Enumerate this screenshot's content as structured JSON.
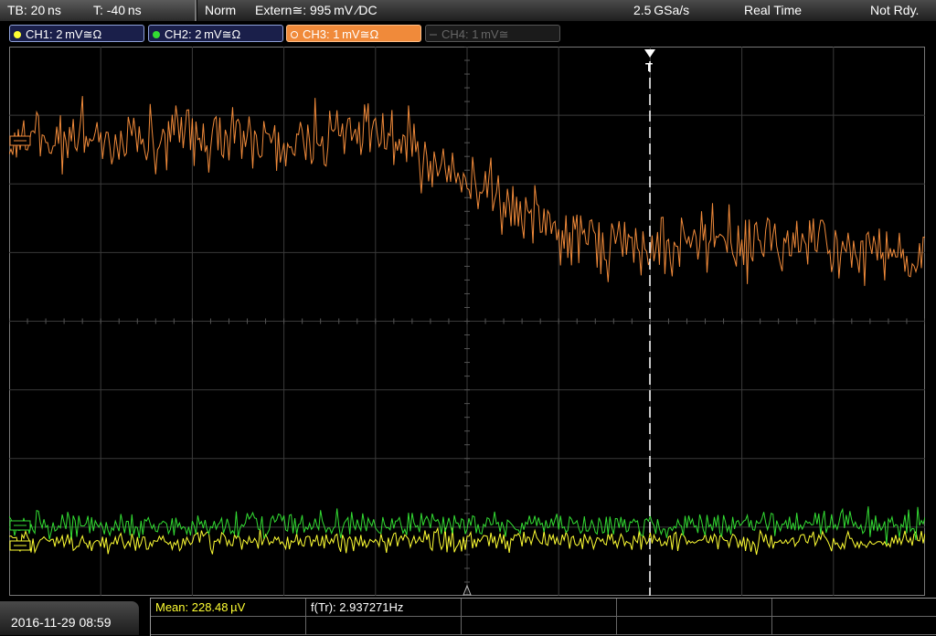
{
  "status": {
    "timebase": "TB: 20 ns",
    "trigger_time": "T: -40 ns",
    "trigger_mode": "Norm",
    "trigger_source": "Extern≅: 995 mV ∕DC",
    "sample_rate": "2.5 GSa/s",
    "acq_mode": "Real Time",
    "acq_state": "Not Rdy."
  },
  "channels": [
    {
      "label": "CH1: 2 mV≅Ω",
      "color": "#ffff33",
      "active": true
    },
    {
      "label": "CH2: 2 mV≅Ω",
      "color": "#33dd33",
      "active": true
    },
    {
      "label": "CH3: 1 mV≅Ω",
      "color": "#f08a3a",
      "active": true
    },
    {
      "label": "CH4: 1 mV≅",
      "color": "#555555",
      "active": false
    }
  ],
  "markers": {
    "trigger": "T"
  },
  "bottom": {
    "date": "2016-11-29 08:59",
    "mean_label": "Mean: 228.48 µV",
    "freq_label": "f(Tr): 2.937271Hz"
  },
  "colors": {
    "ch3": "#f08a3a",
    "ch2": "#33dd33",
    "ch1": "#ffff33",
    "grid": "#3a3a3a",
    "mean_text": "#ffff33"
  }
}
